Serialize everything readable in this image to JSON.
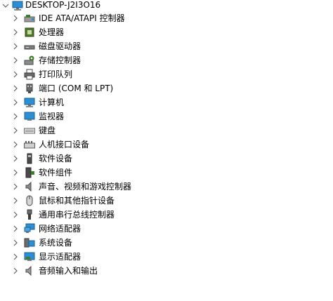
{
  "tree": {
    "root": {
      "label": "DESKTOP-J2I3O16",
      "icon": "computer-icon",
      "expanded": true
    },
    "items": [
      {
        "label": "IDE ATA/ATAPI 控制器",
        "icon": "ide-controller-icon"
      },
      {
        "label": "处理器",
        "icon": "processor-icon"
      },
      {
        "label": "磁盘驱动器",
        "icon": "disk-drive-icon"
      },
      {
        "label": "存储控制器",
        "icon": "storage-controller-icon"
      },
      {
        "label": "打印队列",
        "icon": "printer-icon"
      },
      {
        "label": "端口 (COM 和 LPT)",
        "icon": "port-icon"
      },
      {
        "label": "计算机",
        "icon": "computer-monitor-icon"
      },
      {
        "label": "监视器",
        "icon": "monitor-icon"
      },
      {
        "label": "键盘",
        "icon": "keyboard-icon"
      },
      {
        "label": "人机接口设备",
        "icon": "hid-icon"
      },
      {
        "label": "软件设备",
        "icon": "software-device-icon"
      },
      {
        "label": "软件组件",
        "icon": "software-component-icon"
      },
      {
        "label": "声音、视频和游戏控制器",
        "icon": "speaker-icon"
      },
      {
        "label": "鼠标和其他指针设备",
        "icon": "mouse-icon"
      },
      {
        "label": "通用串行总线控制器",
        "icon": "usb-icon"
      },
      {
        "label": "网络适配器",
        "icon": "network-adapter-icon"
      },
      {
        "label": "系统设备",
        "icon": "system-device-icon"
      },
      {
        "label": "显示适配器",
        "icon": "display-adapter-icon"
      },
      {
        "label": "音频输入和输出",
        "icon": "audio-io-icon"
      }
    ]
  },
  "colors": {
    "chevron": "#5f5f5f",
    "monitor_blue": "#2b8fd6",
    "chip_green": "#4f7a2a"
  }
}
